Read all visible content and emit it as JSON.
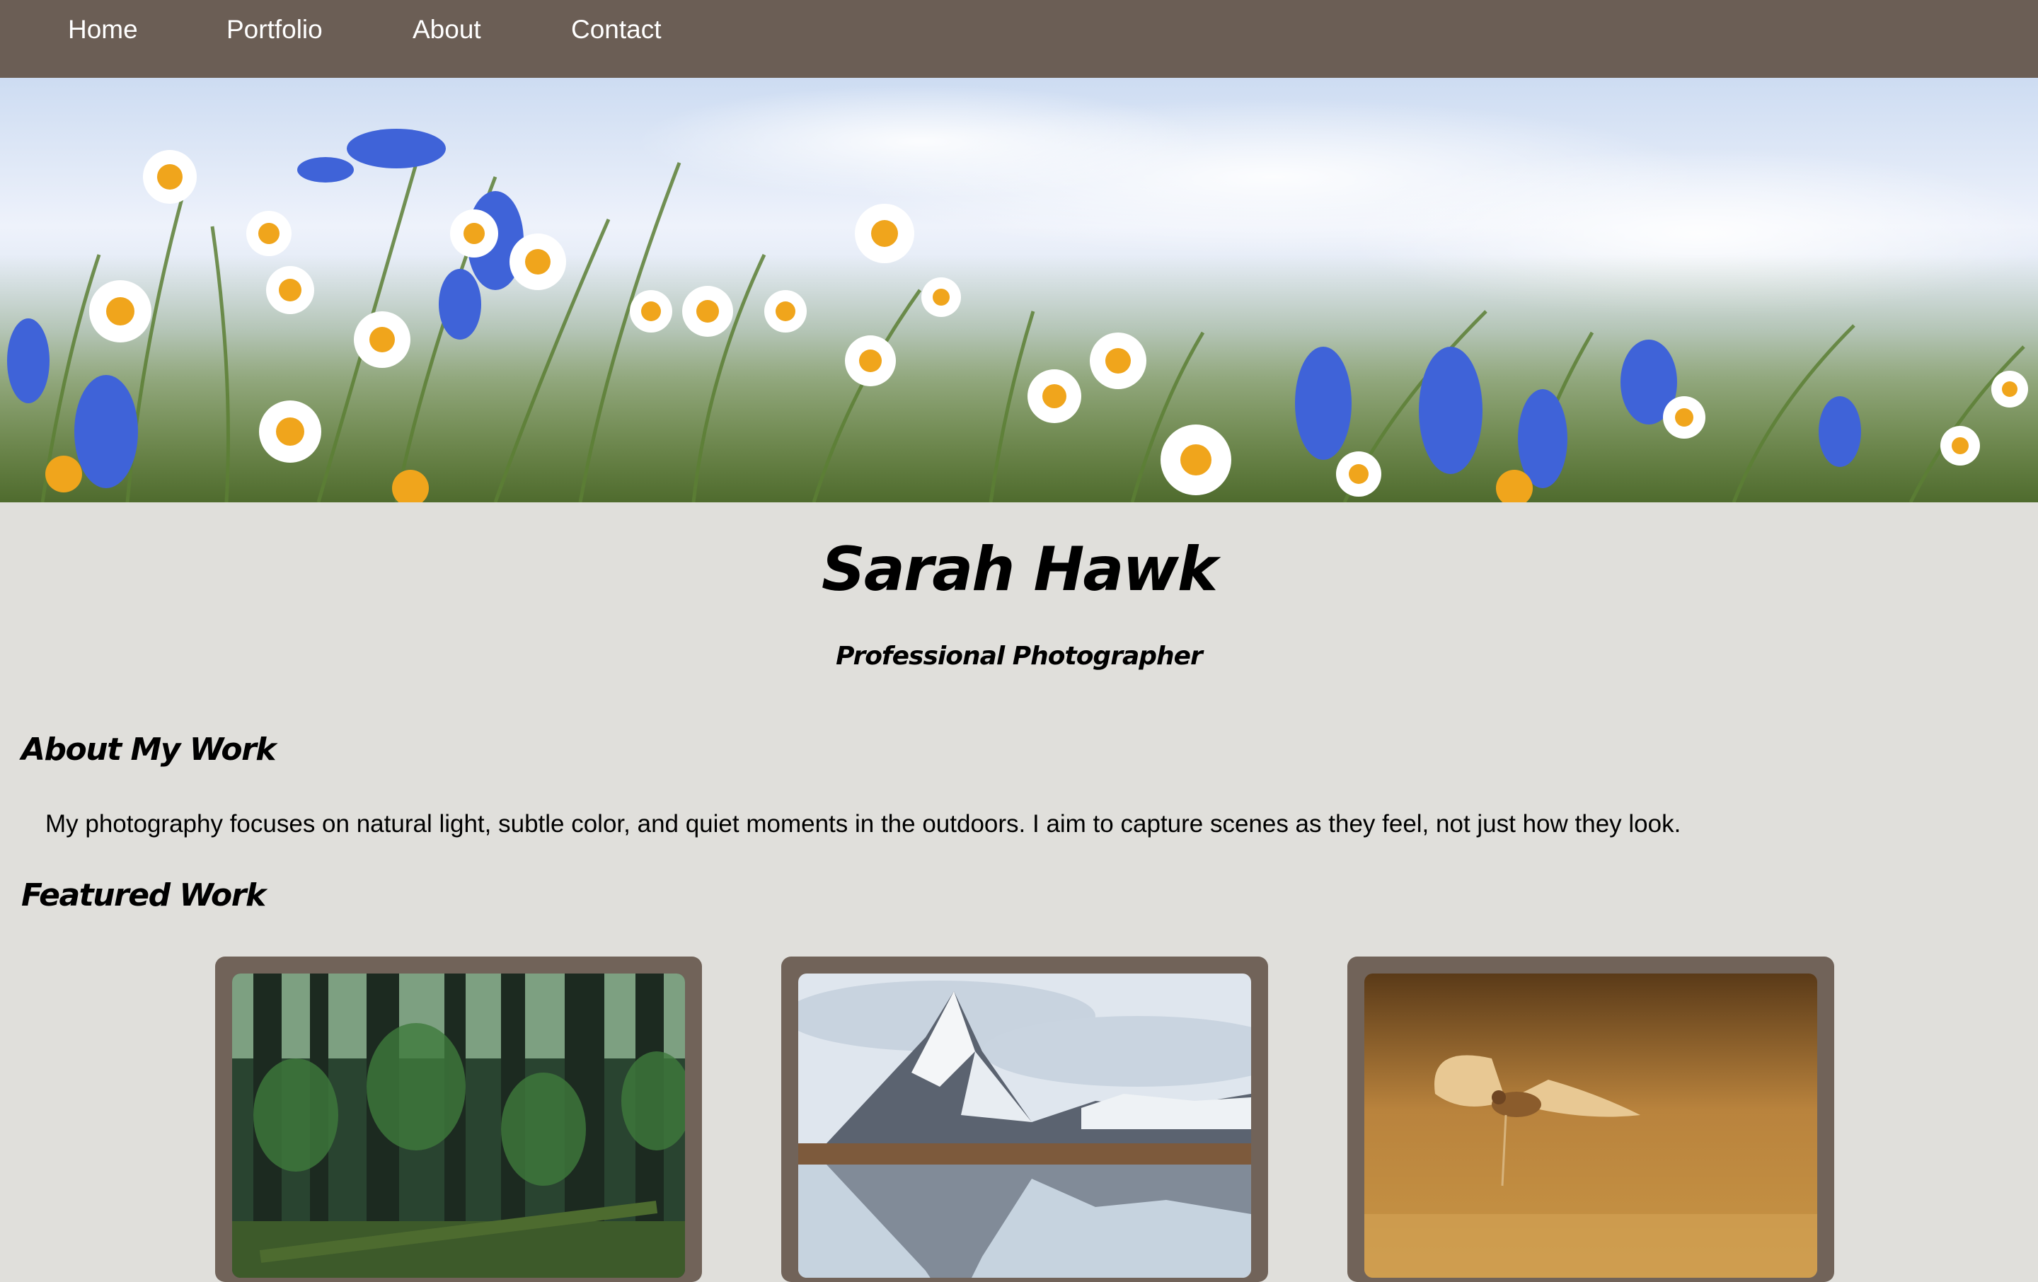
{
  "nav": {
    "items": [
      {
        "label": "Home"
      },
      {
        "label": "Portfolio"
      },
      {
        "label": "About"
      },
      {
        "label": "Contact"
      }
    ]
  },
  "header": {
    "title": "Sarah Hawk",
    "subtitle": "Professional Photographer"
  },
  "about": {
    "heading": "About My Work",
    "text": "My photography focuses on natural light, subtle color, and quiet moments in the outdoors. I aim to capture scenes as they feel, not just how they look."
  },
  "featured": {
    "heading": "Featured Work",
    "photos": [
      {
        "subject": "forest"
      },
      {
        "subject": "mountain-lake"
      },
      {
        "subject": "bird-in-flight"
      }
    ]
  },
  "colors": {
    "nav_background": "#6b5e55",
    "page_background": "#e0dfdb",
    "card_frame": "#716359",
    "nav_text": "#ffffff"
  }
}
